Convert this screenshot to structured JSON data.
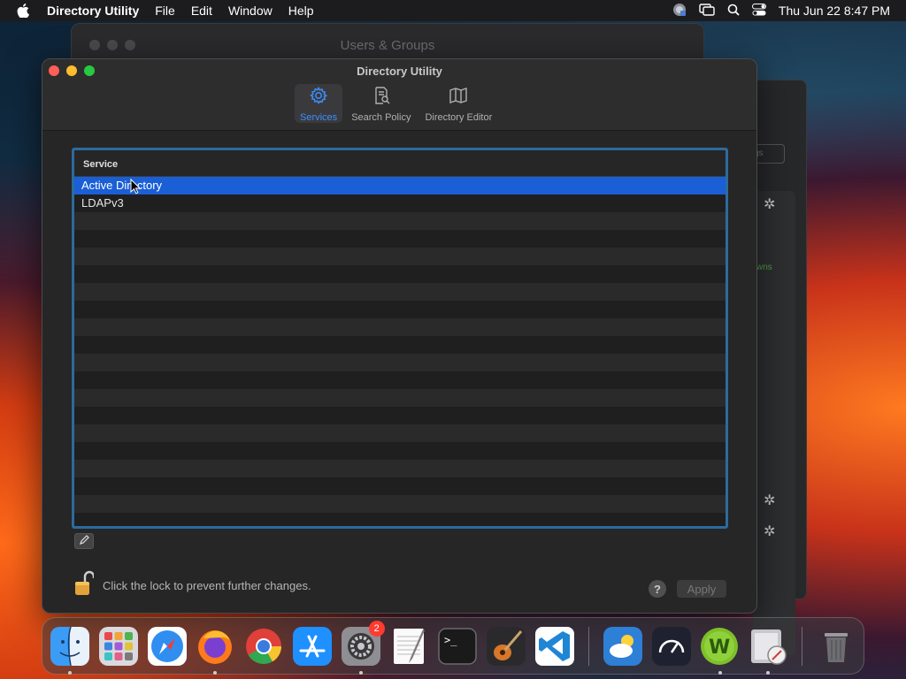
{
  "menubar": {
    "app_name": "Directory Utility",
    "items": [
      "File",
      "Edit",
      "Window",
      "Help"
    ],
    "clock": "Thu Jun 22  8:47 PM"
  },
  "background_window": {
    "title": "Users & Groups",
    "fragment_button": "gs",
    "fragment_green": "wns"
  },
  "window": {
    "title": "Directory Utility",
    "toolbar": [
      {
        "label": "Services",
        "icon": "gear-icon",
        "active": true
      },
      {
        "label": "Search Policy",
        "icon": "search-policy-icon",
        "active": false
      },
      {
        "label": "Directory Editor",
        "icon": "map-icon",
        "active": false
      }
    ],
    "table": {
      "header": "Service",
      "rows": [
        "Active Directory",
        "LDAPv3"
      ],
      "selected_index": 0
    },
    "lock_text": "Click the lock to prevent further changes.",
    "help_label": "?",
    "apply_label": "Apply"
  },
  "dock": {
    "apps": [
      "Finder",
      "Launchpad",
      "Safari",
      "Firefox",
      "Chrome",
      "App Store",
      "System Settings",
      "TextEdit",
      "Terminal",
      "GarageBand",
      "Visual Studio Code",
      "Weather",
      "Activity Monitor",
      "Wunderlist",
      "Directory Utility",
      "Trash"
    ],
    "system_settings_badge": "2"
  },
  "colors": {
    "accent": "#1a5fd6",
    "focus_ring": "#2c6b9e",
    "toolbar_active": "#3d8eff"
  }
}
